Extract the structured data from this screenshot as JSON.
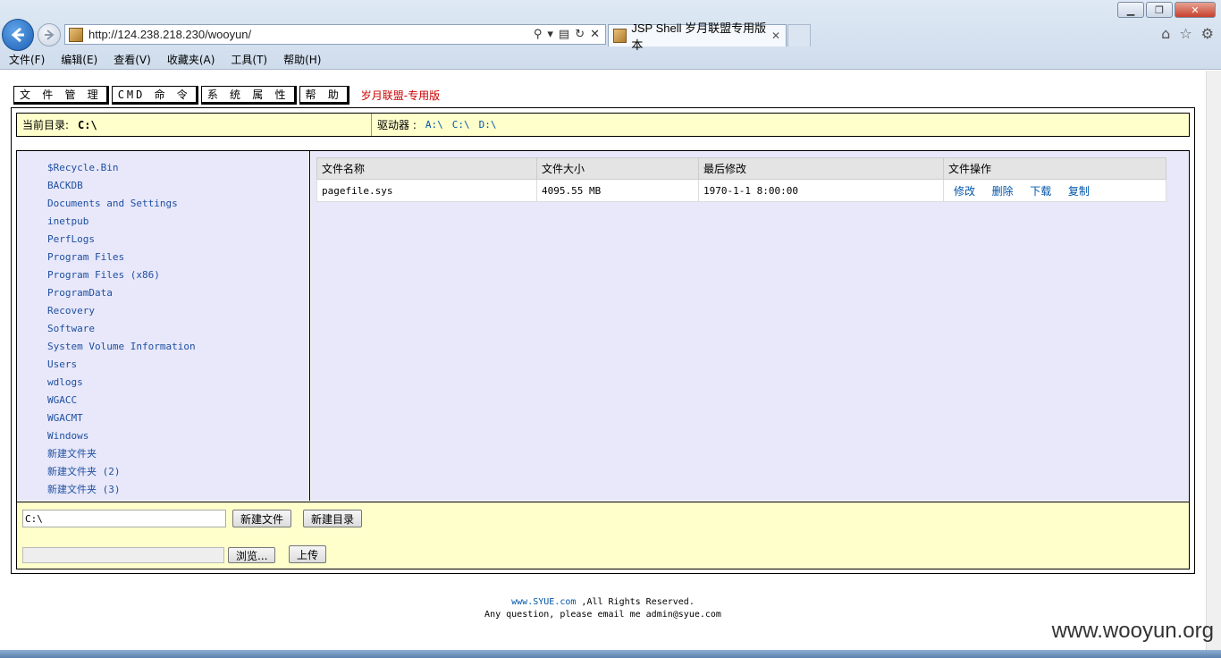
{
  "browser": {
    "url": "http://124.238.218.230/wooyun/",
    "tab_title": "JSP Shell 岁月联盟专用版本",
    "tab_close": "✕",
    "menu": [
      "文件(F)",
      "编辑(E)",
      "查看(V)",
      "收藏夹(A)",
      "工具(T)",
      "帮助(H)"
    ]
  },
  "topnav": {
    "file_manager": "文 件 管 理",
    "cmd": "CMD 命 令",
    "sys_props": "系 统 属 性",
    "help": "帮 助",
    "brand": "岁月联盟-专用版"
  },
  "dirbar": {
    "current_label": "当前目录:",
    "current_value": "C:\\",
    "drives_label": "驱动器 :",
    "drives": [
      "A:\\",
      "C:\\",
      "D:\\"
    ]
  },
  "folders": [
    "$Recycle.Bin",
    "BACKDB",
    "Documents and Settings",
    "inetpub",
    "PerfLogs",
    "Program Files",
    "Program Files (x86)",
    "ProgramData",
    "Recovery",
    "Software",
    "System Volume Information",
    "Users",
    "wdlogs",
    "WGACC",
    "WGACMT",
    "Windows",
    "新建文件夹",
    "新建文件夹 (2)",
    "新建文件夹 (3)"
  ],
  "file_table": {
    "headers": [
      "文件名称",
      "文件大小",
      "最后修改",
      "文件操作"
    ],
    "rows": [
      {
        "name": "pagefile.sys",
        "size": "4095.55 MB",
        "modified": "1970-1-1 8:00:00"
      }
    ],
    "ops": [
      "修改",
      "删除",
      "下载",
      "复制"
    ]
  },
  "bottom": {
    "path_value": "C:\\",
    "new_file": "新建文件",
    "new_dir": "新建目录",
    "browse": "浏览...",
    "upload": "上传"
  },
  "footer": {
    "site": "www.SYUE.com",
    "rights": ",All Rights Reserved.",
    "contact": "Any question, please email me admin@syue.com"
  },
  "watermark": "www.wooyun.org"
}
